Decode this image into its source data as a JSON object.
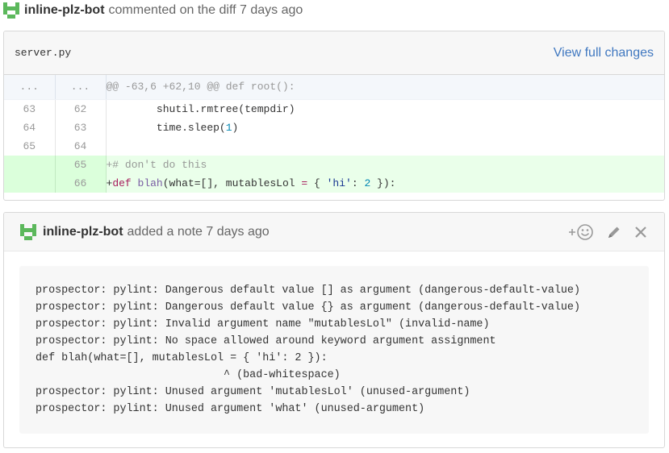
{
  "comment_header": {
    "author": "inline-plz-bot",
    "action_text": "commented on the diff 7 days ago"
  },
  "diff": {
    "file_name": "server.py",
    "view_full_label": "View full changes",
    "hunk": {
      "old_num": "...",
      "new_num": "...",
      "text": "@@ -63,6 +62,10 @@ def root():"
    },
    "context_lines": [
      {
        "old": "63",
        "new": "62",
        "code": "        shutil.rmtree(tempdir)"
      },
      {
        "old": "64",
        "new": "63",
        "code": "        time.sleep(1)"
      },
      {
        "old": "65",
        "new": "64",
        "code": ""
      }
    ],
    "added_lines": [
      {
        "old": "",
        "new": "65",
        "code": "+# don't do this"
      },
      {
        "old": "",
        "new": "66",
        "code": "+def blah(what=[], mutablesLol = { 'hi': 2 }):"
      }
    ]
  },
  "note": {
    "author": "inline-plz-bot",
    "action_text": "added a note 7 days ago",
    "icons": [
      "add-reaction-icon",
      "pencil-icon",
      "close-icon"
    ],
    "body_lines": [
      "prospector: pylint: Dangerous default value [] as argument (dangerous-default-value)",
      "prospector: pylint: Dangerous default value {} as argument (dangerous-default-value)",
      "prospector: pylint: Invalid argument name \"mutablesLol\" (invalid-name)",
      "prospector: pylint: No space allowed around keyword argument assignment",
      "def blah(what=[], mutablesLol = { 'hi': 2 }):",
      "                             ^ (bad-whitespace)",
      "prospector: pylint: Unused argument 'mutablesLol' (unused-argument)",
      "prospector: pylint: Unused argument 'what' (unused-argument)"
    ]
  },
  "colors": {
    "link": "#4078c0",
    "identicon": "#5cb85c",
    "added_bg": "#eaffea",
    "added_num_bg": "#dbffdb",
    "hunk_bg": "#f4f7fb"
  }
}
